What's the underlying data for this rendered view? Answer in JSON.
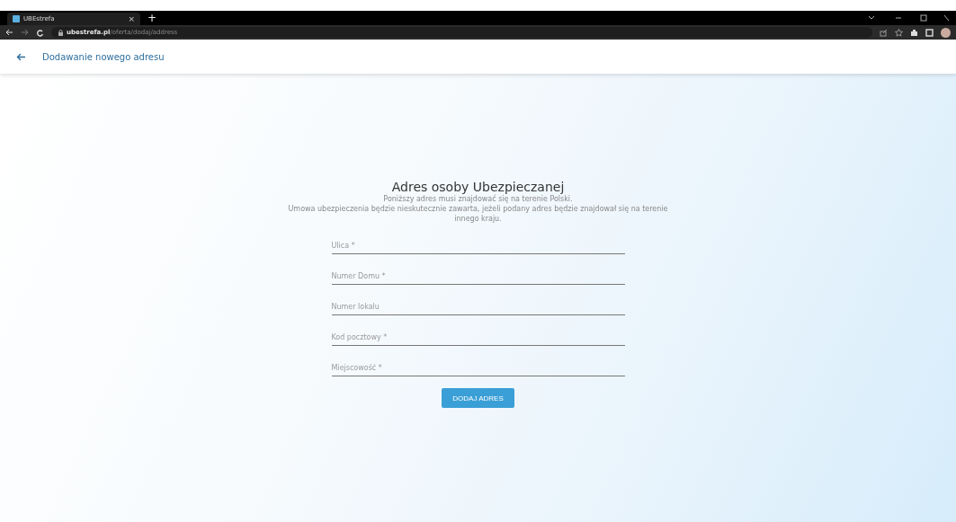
{
  "browser": {
    "tab_title": "UBEstrefa",
    "tab_close": "×",
    "new_tab": "+",
    "url_host": "ubestrefa.pl",
    "url_path": "/oferta/dodaj/address"
  },
  "header": {
    "title": "Dodawanie nowego adresu"
  },
  "form": {
    "title": "Adres osoby Ubezpieczanej",
    "notes": [
      "Poniższy adres musi znajdować się na terenie Polski.",
      "Umowa ubezpieczenia będzie nieskutecznie zawarta, jeżeli podany adres będzie znajdował się na terenie innego kraju."
    ],
    "fields": [
      {
        "placeholder": "Ulica *"
      },
      {
        "placeholder": "Numer Domu *"
      },
      {
        "placeholder": "Numer lokalu"
      },
      {
        "placeholder": "Kod pocztowy *"
      },
      {
        "placeholder": "Miejscowość *"
      }
    ],
    "submit": "DODAJ ADRES"
  }
}
